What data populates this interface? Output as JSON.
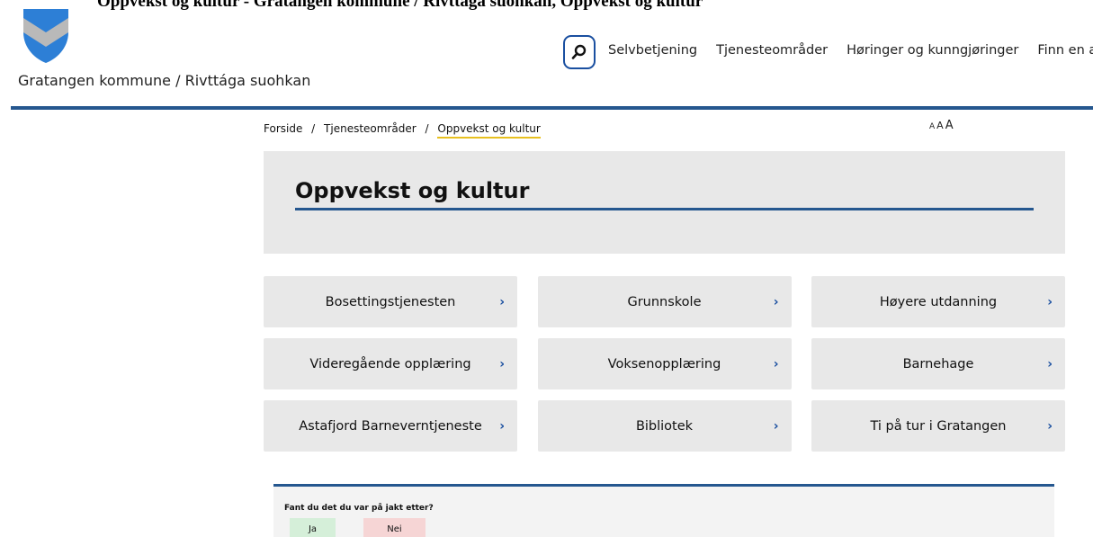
{
  "banner": {
    "text": "Oppvekst og kultur - Gratangen kommune / Rivttága suohkan, Oppvekst og kultur"
  },
  "header": {
    "site_name": "Gratangen kommune / Rivttága suohkan",
    "logo_icon": "coat-of-arms-icon",
    "search_icon": "search-icon",
    "nav": [
      "Selvbetjening",
      "Tjenesteområder",
      "Høringer og kunngjøringer",
      "Finn en ans"
    ]
  },
  "breadcrumb": {
    "items": [
      "Forside",
      "Tjenesteområder"
    ],
    "current": "Oppvekst og kultur",
    "separator": "/"
  },
  "textsize": [
    "A",
    "A",
    "A"
  ],
  "hero": {
    "title": "Oppvekst og kultur"
  },
  "tiles": [
    {
      "label": "Bosettingstjenesten",
      "icon": "chevron-right-icon"
    },
    {
      "label": "Grunnskole",
      "icon": "chevron-right-icon"
    },
    {
      "label": "Høyere utdanning",
      "icon": "chevron-right-icon"
    },
    {
      "label": "Videregående opplæring",
      "icon": "chevron-right-icon"
    },
    {
      "label": "Voksenopplæring",
      "icon": "chevron-right-icon"
    },
    {
      "label": "Barnehage",
      "icon": "chevron-right-icon"
    },
    {
      "label": "Astafjord Barneverntjeneste",
      "icon": "chevron-right-icon"
    },
    {
      "label": "Bibliotek",
      "icon": "chevron-right-icon"
    },
    {
      "label": "Ti på tur i Gratangen",
      "icon": "chevron-right-icon"
    }
  ],
  "chevron_glyph": "›",
  "feedback": {
    "question": "Fant du det du var på jakt etter?",
    "yes": "Ja",
    "no": "Nei"
  },
  "colors": {
    "accent_blue": "#25578f",
    "breadcrumb_underline": "#e8c01f",
    "tile_bg": "#e8e8e8",
    "yes_bg": "#d5efd9",
    "no_bg": "#f6d5d5"
  }
}
